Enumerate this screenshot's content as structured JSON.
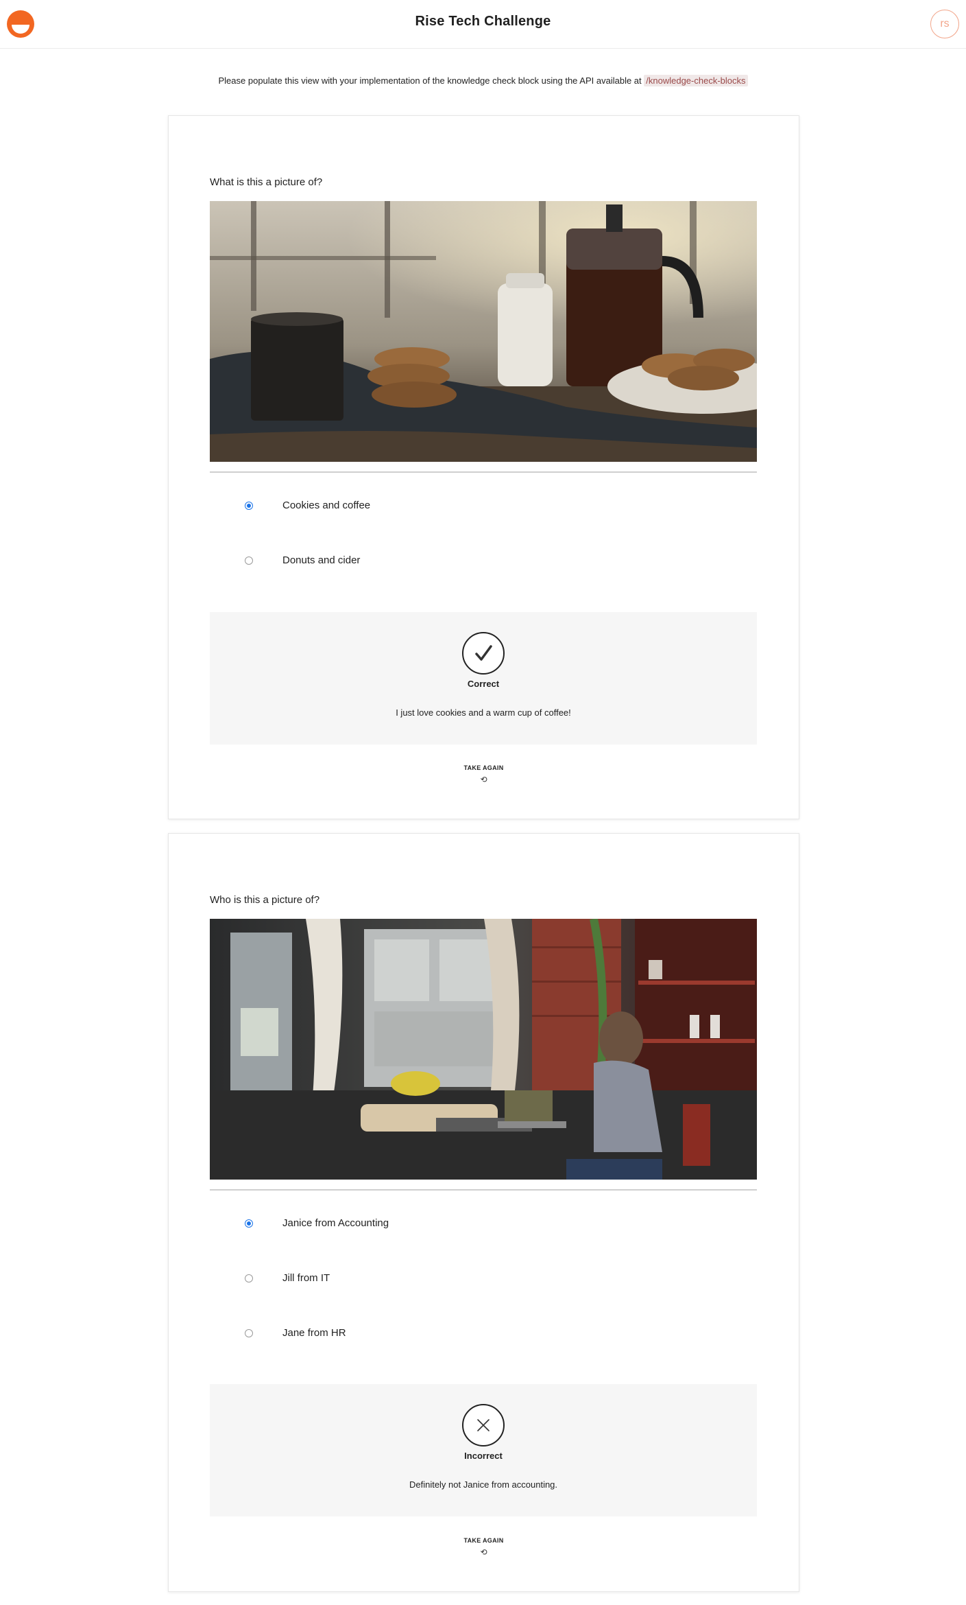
{
  "header": {
    "title": "Rise Tech Challenge",
    "avatar_initials": "rs",
    "logo_color": "#f26722"
  },
  "intro": {
    "text": "Please populate this view with your implementation of the knowledge check block using the API available at",
    "endpoint": "/knowledge-check-blocks"
  },
  "blocks": [
    {
      "question": "What is this a picture of?",
      "image_subject": "cookies-and-coffee-photo",
      "options": [
        {
          "label": "Cookies and coffee",
          "selected": true
        },
        {
          "label": "Donuts and cider",
          "selected": false
        }
      ],
      "feedback": {
        "status": "Correct",
        "icon": "checkmark-icon",
        "text": "I just love cookies and a warm cup of coffee!"
      },
      "take_again_label": "TAKE AGAIN",
      "take_again_icon": "⟲"
    },
    {
      "question": "Who is this a picture of?",
      "image_subject": "woman-at-cafe-laptop-photo",
      "options": [
        {
          "label": "Janice from Accounting",
          "selected": true
        },
        {
          "label": "Jill from IT",
          "selected": false
        },
        {
          "label": "Jane from HR",
          "selected": false
        }
      ],
      "feedback": {
        "status": "Incorrect",
        "icon": "x-icon",
        "text": "Definitely not Janice from accounting."
      },
      "take_again_label": "TAKE AGAIN",
      "take_again_icon": "⟲"
    }
  ],
  "colors": {
    "radio_selected": "#1a73e8",
    "feedback_bg": "#f6f6f6"
  }
}
